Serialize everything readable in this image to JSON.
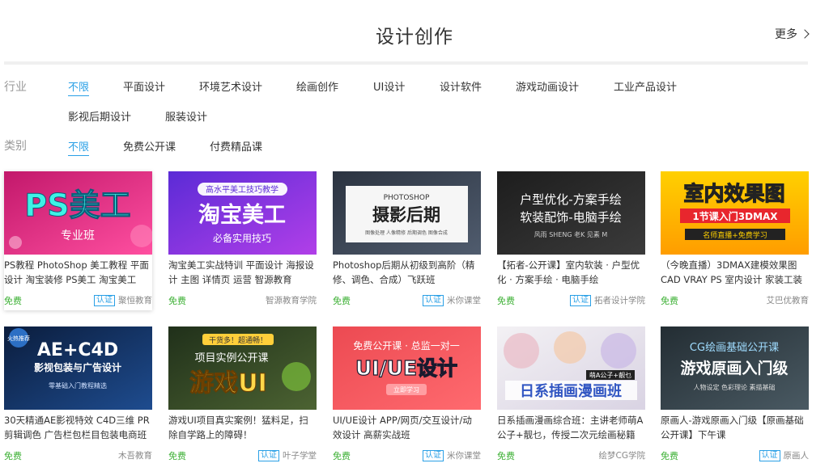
{
  "header": {
    "title": "设计创作",
    "more_label": "更多"
  },
  "filters": {
    "industry": {
      "label": "行业",
      "items": [
        "不限",
        "平面设计",
        "环境艺术设计",
        "绘画创作",
        "UI设计",
        "设计软件",
        "游戏动画设计",
        "工业产品设计",
        "影视后期设计",
        "服装设计"
      ]
    },
    "category": {
      "label": "类别",
      "items": [
        "不限",
        "免费公开课",
        "付费精品课"
      ]
    }
  },
  "courses": [
    {
      "title": "PS教程 PhotoShop  美工教程 平面设计 淘宝装修 PS美工 淘宝美工",
      "price": "免费",
      "verified": true,
      "verified_label": "认证",
      "provider": "聚恒教育",
      "thumb": {
        "text": "PS美工",
        "sub": "专业班",
        "colors": [
          "#c2186b",
          "#ff4fa0"
        ]
      }
    },
    {
      "title": "淘宝美工实战特训 平面设计 海报设计 主图 详情页 运营 智源教育",
      "price": "免费",
      "verified": false,
      "provider": "智源教育学院",
      "thumb": {
        "top": "高水平美工技巧教学",
        "text": "淘宝美工",
        "sub": "必备实用技巧",
        "colors": [
          "#5b2bd6",
          "#b13fe8"
        ]
      }
    },
    {
      "title": "Photoshop后期从初级到高阶（精修、调色、合成）飞跃班",
      "price": "免费",
      "verified": true,
      "verified_label": "认证",
      "provider": "米你课堂",
      "thumb": {
        "top": "PHOTOSHOP",
        "text": "摄影后期",
        "sub": "图像处理 人像精修 后期调色 图像合成",
        "colors": [
          "#2b3340",
          "#505c6e"
        ]
      }
    },
    {
      "title": "【拓者-公开课】室内软装 · 户型优化 · 方案手绘 · 电脑手绘",
      "price": "免费",
      "verified": true,
      "verified_label": "认证",
      "provider": "拓者设计学院",
      "thumb": {
        "text": "户型优化-方案手绘",
        "text2": "软装配饰-电脑手绘",
        "sub": "风雨  SHENG  老K  见素  M",
        "colors": [
          "#1d1d1d",
          "#3b3b3b"
        ]
      }
    },
    {
      "title": "（今晚直播）3DMAX建模效果图 CAD VRAY PS 室内设计 家装工装",
      "price": "免费",
      "verified": false,
      "provider": "艾巴优教育",
      "thumb": {
        "text": "室内效果图",
        "text2": "1节课入门3DMAX",
        "sub": "名师直播+免费学习",
        "colors": [
          "#ffd000",
          "#ff9d00"
        ]
      }
    },
    {
      "title": "30天精通AE影视特效 C4D三维 PR剪辑调色 广告栏包栏目包装电商班",
      "price": "免费",
      "verified": false,
      "provider": "木吾教育",
      "thumb": {
        "top": "火热推荐",
        "text": "AE+C4D",
        "text2": "影视包装与广告设计",
        "sub": "零基础入门教程精选",
        "colors": [
          "#0b1d3d",
          "#1e4c8f"
        ]
      }
    },
    {
      "title": "游戏UI项目真实案例！猛料足，扫除自学路上的障碍！",
      "price": "免费",
      "verified": true,
      "verified_label": "认证",
      "provider": "叶子学堂",
      "thumb": {
        "top": "干货多！超通畅！",
        "text": "游戏UI",
        "text2": "项目实例公开课",
        "colors": [
          "#20301a",
          "#4c6332"
        ]
      }
    },
    {
      "title": "UI/UE设计 APP/网页/交互设计/动效设计 高薪实战班",
      "price": "免费",
      "verified": true,
      "verified_label": "认证",
      "provider": "米你课堂",
      "thumb": {
        "top": "免费公开课 · 总监一对一",
        "text": "UI/UE设计",
        "sub": "立即学习",
        "colors": [
          "#ec4a52",
          "#ff6a6f"
        ]
      }
    },
    {
      "title": "日系插画漫画综合班：主讲老师萌A公子+靓乜，传授二次元绘画秘籍",
      "price": "免费",
      "verified": false,
      "provider": "绘梦CG学院",
      "thumb": {
        "text": "日系插画漫画班",
        "top": "萌A公子+靓乜",
        "colors": [
          "#f3f1f4",
          "#d9d3e3"
        ]
      }
    },
    {
      "title": "原画人-游戏原画入门级【原画基础公开课】下午课",
      "price": "免费",
      "verified": true,
      "verified_label": "认证",
      "provider": "原画人",
      "thumb": {
        "top": "CG绘画基础公开课",
        "text": "游戏原画入门级",
        "sub": "人物设定 色彩理论 素描基础",
        "colors": [
          "#232d33",
          "#4a5a63"
        ]
      }
    }
  ]
}
